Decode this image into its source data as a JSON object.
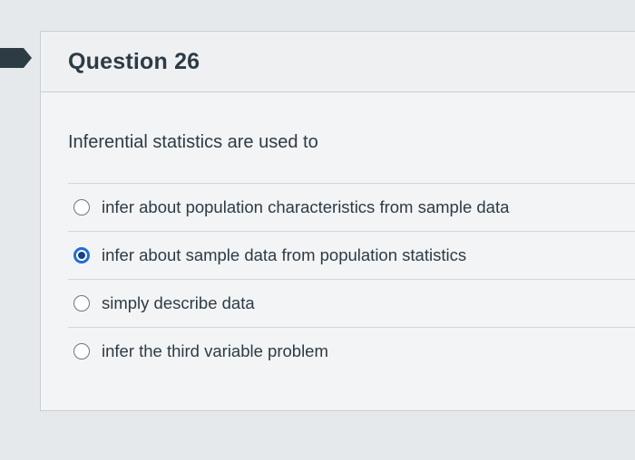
{
  "question": {
    "title": "Question 26",
    "text": "Inferential statistics are used to",
    "answers": [
      {
        "label": "infer about population characteristics from sample data",
        "selected": false
      },
      {
        "label": "infer about sample data from population statistics",
        "selected": true
      },
      {
        "label": "simply describe data",
        "selected": false
      },
      {
        "label": "infer the third variable problem",
        "selected": false
      }
    ]
  },
  "colors": {
    "flag_marker": "#2d3b45",
    "radio_selected": "#1f6fd6"
  },
  "icons": {
    "marker": "flag-marker-icon"
  }
}
